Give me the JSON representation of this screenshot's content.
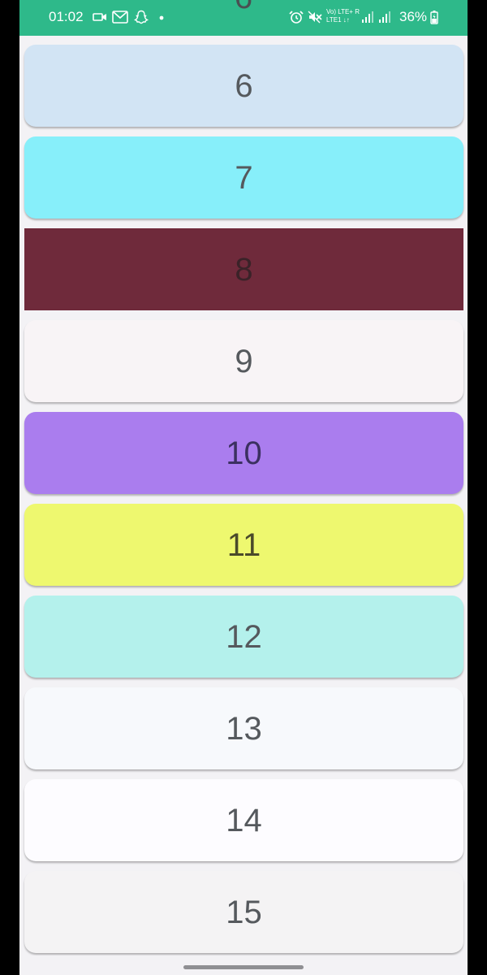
{
  "status_bar": {
    "time": "01:02",
    "network_line1": "Vo) LTE+ R",
    "network_line2": "LTE1 ↓↑",
    "battery": "36%",
    "background": "#2eb98a"
  },
  "peek_item": "6",
  "items": [
    {
      "label": "6",
      "color": "#d2e4f4"
    },
    {
      "label": "7",
      "color": "#87effa"
    },
    {
      "label": "8",
      "color": "#6f2a3b"
    },
    {
      "label": "9",
      "color": "#f8f4f6"
    },
    {
      "label": "10",
      "color": "#aa7dee"
    },
    {
      "label": "11",
      "color": "#eef86f"
    },
    {
      "label": "12",
      "color": "#b4f1ec"
    },
    {
      "label": "13",
      "color": "#f7f9fc"
    },
    {
      "label": "14",
      "color": "#fdfcff"
    },
    {
      "label": "15",
      "color": "#f4f3f4"
    }
  ]
}
